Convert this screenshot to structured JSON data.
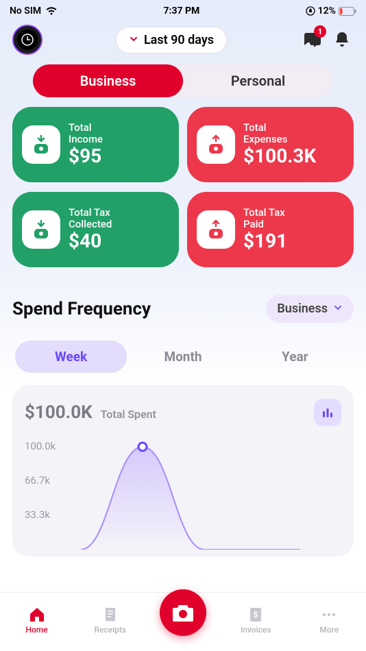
{
  "status": {
    "carrier": "No SIM",
    "time": "7:37 PM",
    "battery_pct": "12%"
  },
  "header": {
    "period_label": "Last 90 days",
    "notification_badge": "1"
  },
  "segmented": {
    "business": "Business",
    "personal": "Personal"
  },
  "cards": {
    "income": {
      "label1": "Total",
      "label2": "Income",
      "value": "$95"
    },
    "expenses": {
      "label1": "Total",
      "label2": "Expenses",
      "value": "$100.3K"
    },
    "tax_collected": {
      "label1": "Total Tax",
      "label2": "Collected",
      "value": "$40"
    },
    "tax_paid": {
      "label1": "Total Tax",
      "label2": "Paid",
      "value": "$191"
    }
  },
  "spend": {
    "title": "Spend Frequency",
    "filter": "Business",
    "tabs": {
      "week": "Week",
      "month": "Month",
      "year": "Year"
    },
    "total_value": "$100.0K",
    "total_label": "Total Spent",
    "y_ticks": [
      "100.0k",
      "66.7k",
      "33.3k"
    ]
  },
  "nav": {
    "home": "Home",
    "receipts": "Receipts",
    "invoices": "Invoices",
    "more": "More"
  },
  "chart_data": {
    "type": "line",
    "title": "Spend Frequency — Week",
    "ylabel": "Total Spent",
    "ylim": [
      0,
      100000
    ],
    "x": [
      0,
      1,
      2,
      3,
      4,
      5,
      6
    ],
    "values": [
      0,
      0,
      100000,
      0,
      0,
      0,
      0
    ]
  }
}
